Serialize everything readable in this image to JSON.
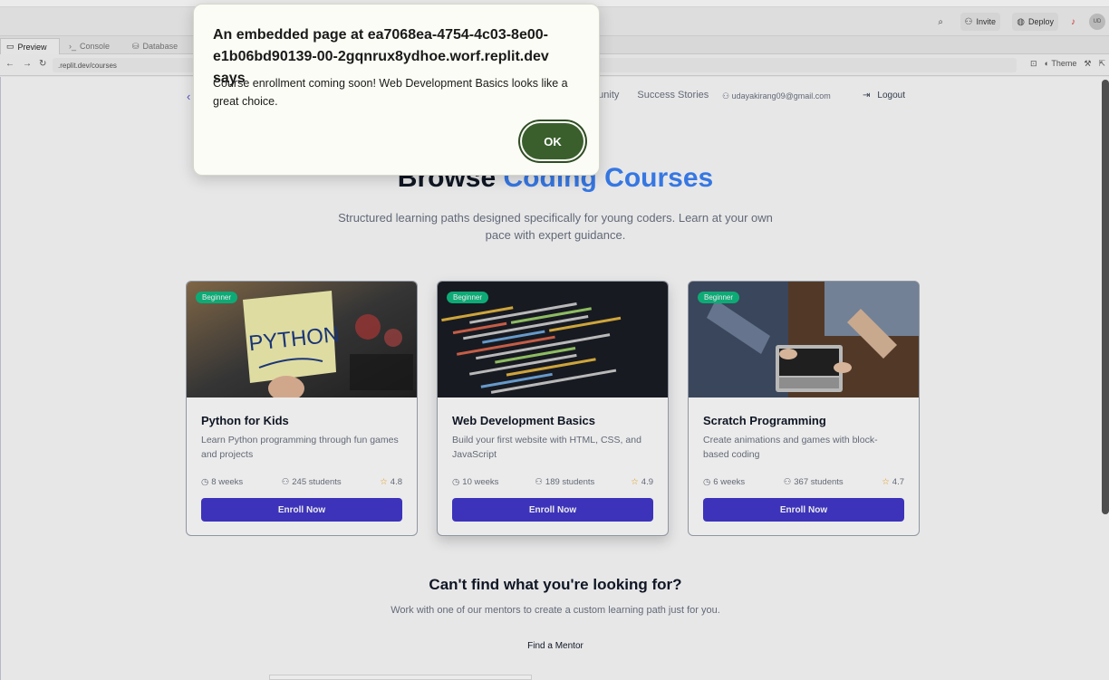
{
  "replit": {
    "topbar": {
      "invite_label": "Invite",
      "deploy_label": "Deploy",
      "avatar_initials": "UD"
    },
    "tabs": [
      {
        "label": "Preview"
      },
      {
        "label": "Console"
      },
      {
        "label": "Database"
      }
    ],
    "url": ".replit.dev/courses",
    "theme_label": "Theme"
  },
  "site": {
    "nav": {
      "links": [
        "munity",
        "Success Stories"
      ],
      "user_email": "udayakirang09@gmail.com",
      "logout_label": "Logout"
    },
    "hero": {
      "title_main": "Browse ",
      "title_accent": "Coding Courses",
      "subtitle": "Structured learning paths designed specifically for young coders. Learn at your own pace with expert guidance."
    },
    "courses": [
      {
        "badge": "Beginner",
        "title": "Python for Kids",
        "description": "Learn Python programming through fun games and projects",
        "duration": "8 weeks",
        "students": "245 students",
        "rating": "4.8",
        "button": "Enroll Now",
        "note_text": "PYTHON"
      },
      {
        "badge": "Beginner",
        "title": "Web Development Basics",
        "description": "Build your first website with HTML, CSS, and JavaScript",
        "duration": "10 weeks",
        "students": "189 students",
        "rating": "4.9",
        "button": "Enroll Now"
      },
      {
        "badge": "Beginner",
        "title": "Scratch Programming",
        "description": "Create animations and games with block-based coding",
        "duration": "6 weeks",
        "students": "367 students",
        "rating": "4.7",
        "button": "Enroll Now"
      }
    ],
    "cta": {
      "title": "Can't find what you're looking for?",
      "subtitle": "Work with one of our mentors to create a custom learning path just for you.",
      "link": "Find a Mentor"
    }
  },
  "dialog": {
    "title": "An embedded page at ea7068ea-4754-4c03-8e00-e1b06bd90139-00-2gqnrux8ydhoe.worf.replit.dev says",
    "message": "Course enrollment coming soon! Web Development Basics looks like a great choice.",
    "ok_label": "OK"
  },
  "colors": {
    "accent": "#3b82f6",
    "button": "#4338ca",
    "badge": "#10b981",
    "dialog_ok": "#3a5f2d",
    "star": "#f59e0b"
  }
}
